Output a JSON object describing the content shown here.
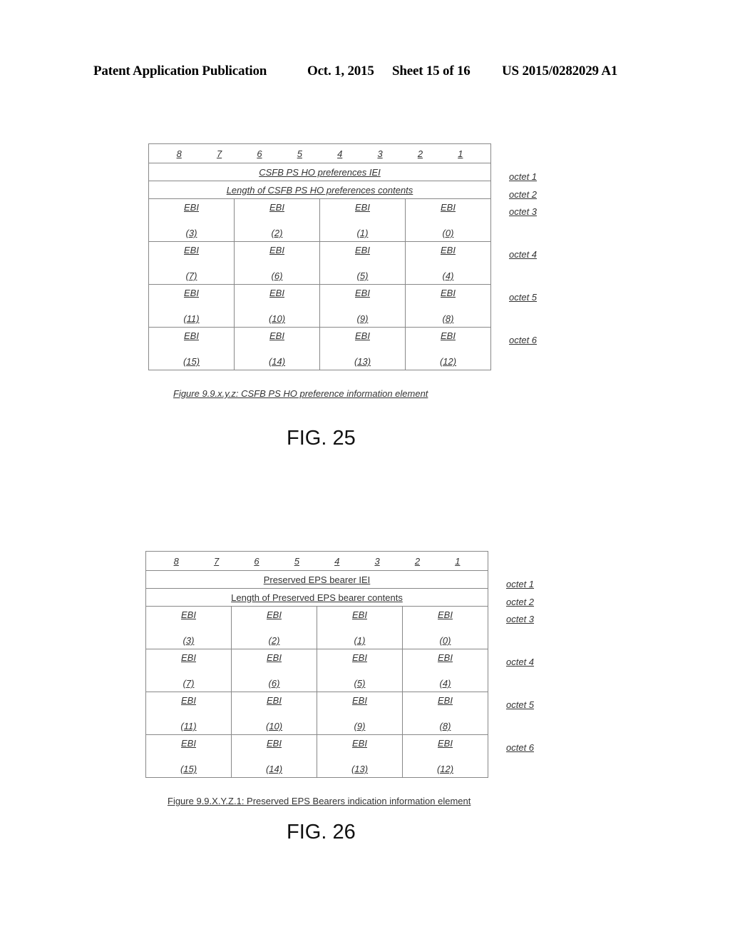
{
  "header": {
    "publication": "Patent Application Publication",
    "date": "Oct. 1, 2015",
    "sheet": "Sheet 15 of 16",
    "number": "US 2015/0282029 A1"
  },
  "figures": [
    {
      "bits": [
        "8",
        "7",
        "6",
        "5",
        "4",
        "3",
        "2",
        "1"
      ],
      "iei": "CSFB PS HO preferences IEI",
      "length": "Length of CSFB PS HO preferences contents",
      "ebi_label": "EBI",
      "ebi_rows": [
        [
          "(3)",
          "(2)",
          "(1)",
          "(0)"
        ],
        [
          "(7)",
          "(6)",
          "(5)",
          "(4)"
        ],
        [
          "(11)",
          "(10)",
          "(9)",
          "(8)"
        ],
        [
          "(15)",
          "(14)",
          "(13)",
          "(12)"
        ]
      ],
      "octets": [
        "octet 1",
        "octet 2",
        "octet 3",
        "octet 4",
        "octet 5",
        "octet 6"
      ],
      "caption": "Figure 9.9.x.y.z: CSFB PS HO preference information element",
      "label": "FIG. 25"
    },
    {
      "bits": [
        "8",
        "7",
        "6",
        "5",
        "4",
        "3",
        "2",
        "1"
      ],
      "iei": "Preserved EPS bearer IEI",
      "length": "Length of Preserved EPS bearer contents",
      "ebi_label": "EBI",
      "ebi_rows": [
        [
          "(3)",
          "(2)",
          "(1)",
          "(0)"
        ],
        [
          "(7)",
          "(6)",
          "(5)",
          "(4)"
        ],
        [
          "(11)",
          "(10)",
          "(9)",
          "(8)"
        ],
        [
          "(15)",
          "(14)",
          "(13)",
          "(12)"
        ]
      ],
      "octets": [
        "octet 1",
        "octet 2",
        "octet 3",
        "octet 4",
        "octet 5",
        "octet 6"
      ],
      "caption": "Figure 9.9.X.Y.Z.1: Preserved EPS Bearers indication information element",
      "label": "FIG. 26"
    }
  ]
}
